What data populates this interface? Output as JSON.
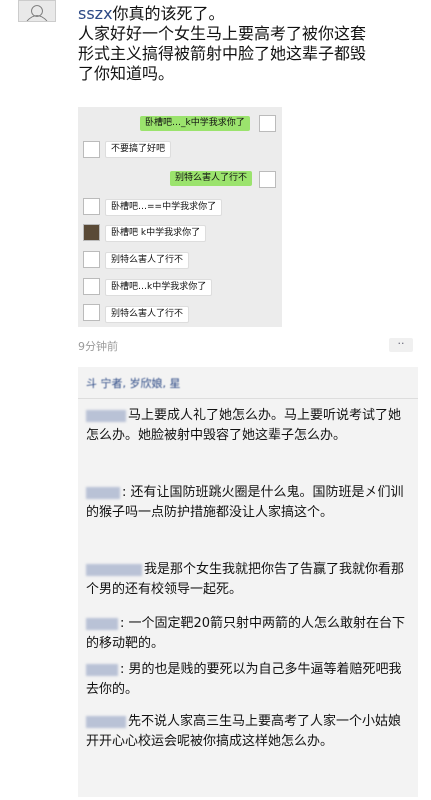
{
  "post": {
    "author": "sszx",
    "text_line1": "你真的该死了。",
    "text_line2": "人家好好一个女生马上要高考了被你这套",
    "text_line3": "形式主义搞得被箭射中脸了她这辈子都毁",
    "text_line4": "了你知道吗。",
    "time": "9分钟前",
    "more_label": "··"
  },
  "chat": {
    "messages": [
      {
        "side": "right",
        "text": "卧槽吧…_k中学我求你了"
      },
      {
        "side": "left",
        "text": "不要搞了好吧"
      },
      {
        "side": "right",
        "text": "别特么害人了行不"
      },
      {
        "side": "left",
        "text": "卧槽吧…==中学我求你了"
      },
      {
        "side": "left",
        "text": "卧槽吧  k中学我求你了"
      },
      {
        "side": "left",
        "text": "别特么害人了行不"
      },
      {
        "side": "left",
        "text": "卧槽吧…k中学我求你了"
      },
      {
        "side": "left",
        "text": "别特么害人了行不"
      }
    ]
  },
  "comments": {
    "header": "斗 宁者, 岁欣娘, 星",
    "items": [
      {
        "name": "▇▇",
        "text": "马上要成人礼了她怎么办。马上要听说考试了她怎么办。她脸被射中毁容了她这辈子怎么办。"
      },
      {
        "name": "▇▇▇",
        "text": ": 还有让国防班跳火圈是什么鬼。国防班是㐅们训的猴子吗一点防护措施都没让人家搞这个。"
      },
      {
        "name": "▇▇▇",
        "text": "我是那个女生我就把你告了告赢了我就你看那个男的还有校领导一起死。"
      },
      {
        "name": "▇▇▇",
        "text": ": 一个固定靶20箭只射中两箭的人怎么敢射在台下的移动靶的。"
      },
      {
        "name": "▇▇▇",
        "text": ": 男的也是贱的要死以为自己多牛逼等着赔死吧我去你的。"
      },
      {
        "name": "▇▇▇",
        "text": "先不说人家高三生马上要高考了人家一个小姑娘开开心心校运会呢被你搞成这样她怎么办。"
      }
    ]
  }
}
